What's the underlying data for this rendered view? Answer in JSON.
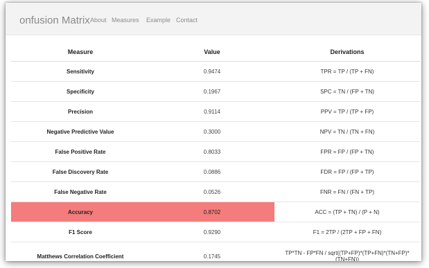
{
  "nav": {
    "brand": "onfusion Matrix",
    "links": [
      "About",
      "Measures",
      "Example",
      "Contact"
    ]
  },
  "table": {
    "headers": {
      "measure": "Measure",
      "value": "Value",
      "derivations": "Derivations"
    },
    "rows": [
      {
        "measure": "Sensitivity",
        "value": "0.9474",
        "derivation": "TPR = TP / (TP + FN)"
      },
      {
        "measure": "Specificity",
        "value": "0.1967",
        "derivation": "SPC = TN / (FP + TN)"
      },
      {
        "measure": "Precision",
        "value": "0.9114",
        "derivation": "PPV = TP / (TP + FP)"
      },
      {
        "measure": "Negative Predictive Value",
        "value": "0.3000",
        "derivation": "NPV = TN / (TN + FN)"
      },
      {
        "measure": "False Positive Rate",
        "value": "0.8033",
        "derivation": "FPR = FP / (FP + TN)"
      },
      {
        "measure": "False Discovery Rate",
        "value": "0.0886",
        "derivation": "FDR = FP / (FP + TP)"
      },
      {
        "measure": "False Negative Rate",
        "value": "0.0526",
        "derivation": "FNR = FN / (FN + TP)"
      },
      {
        "measure": "Accuracy",
        "value": "0.8702",
        "derivation": "ACC = (TP + TN) / (P + N)",
        "highlighted": true
      },
      {
        "measure": "F1 Score",
        "value": "0.9290",
        "derivation": "F1 = 2TP / (2TP + FP + FN)"
      },
      {
        "measure": "Matthews Correlation Coefficient",
        "value": "0.1745",
        "derivation": "TP*TN - FP*FN / sqrt((TP+FP)*(TP+FN)*(TN+FP)*(TN+FN))"
      }
    ]
  },
  "colors": {
    "highlight": "#f47c7c",
    "nav_background": "#f3f3f3"
  }
}
